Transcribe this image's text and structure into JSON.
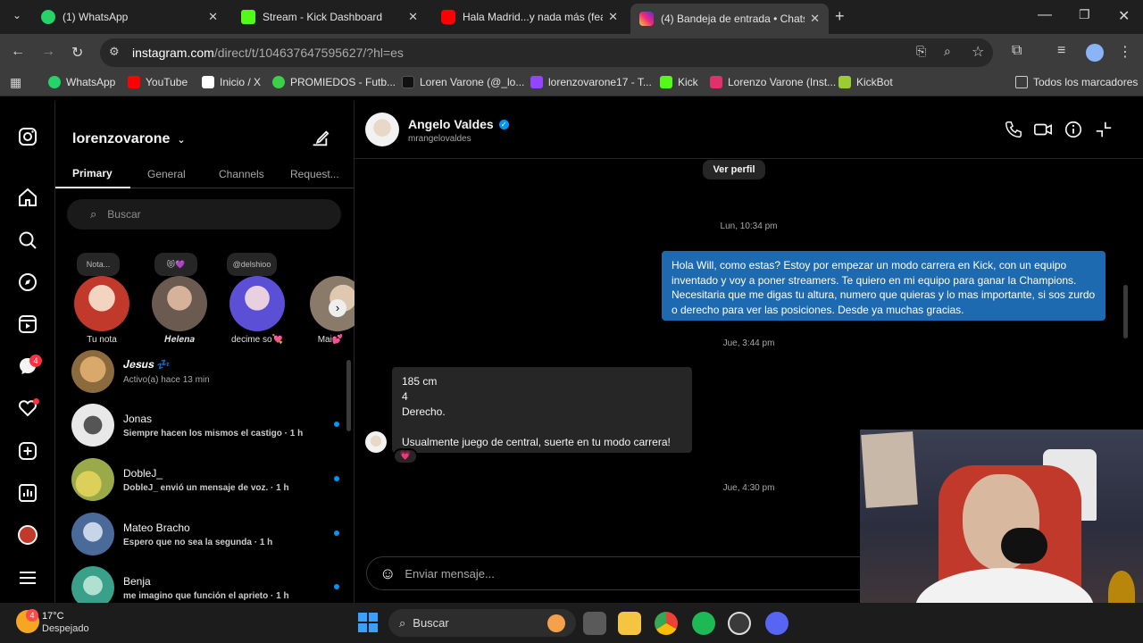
{
  "browser": {
    "tabs": [
      {
        "title": "(1) WhatsApp",
        "color": "#25d366"
      },
      {
        "title": "Stream - Kick Dashboard",
        "color": "#53fc18"
      },
      {
        "title": "Hala Madrid...y nada más (feat.",
        "color": "#ff0000"
      },
      {
        "title": "(4) Bandeja de entrada • Chats",
        "color": "#e1306c"
      }
    ],
    "url_host": "instagram.com",
    "url_path": "/direct/t/104637647595627/?hl=es",
    "bookmarks": [
      {
        "label": "WhatsApp",
        "color": "#25d366"
      },
      {
        "label": "YouTube",
        "color": "#ff0000"
      },
      {
        "label": "Inicio / X",
        "color": "#ffffff"
      },
      {
        "label": "PROMIEDOS - Futb...",
        "color": "#3ecf4a"
      },
      {
        "label": "Loren Varone (@_lo...",
        "color": "#111111"
      },
      {
        "label": "lorenzovarone17 - T...",
        "color": "#9146ff"
      },
      {
        "label": "Kick",
        "color": "#53fc18"
      },
      {
        "label": "Lorenzo Varone (Inst...",
        "color": "#e1306c"
      },
      {
        "label": "KickBot",
        "color": "#9acd32"
      }
    ],
    "all_bookmarks": "Todos los marcadores"
  },
  "inbox": {
    "username": "lorenzovarone",
    "tabs": [
      "Primary",
      "General",
      "Channels",
      "Request..."
    ],
    "search_placeholder": "Buscar",
    "stories": [
      {
        "note": "Nota...",
        "name": "Tu nota",
        "color": "#c0392b"
      },
      {
        "note": "😻💜",
        "name": "𝑯𝒆𝒍𝒆𝒏𝒂",
        "color": "#6b5a4f"
      },
      {
        "note": "@delshioo",
        "name": "decime so💘",
        "color": "#5b4fd6"
      },
      {
        "note": "😻",
        "name": "Mai💕",
        "color": "#8a7a6a"
      }
    ],
    "conversations": [
      {
        "name": "𝑱𝒆𝒔𝒖𝒔 💤",
        "preview": "Activo(a) hace 13 min",
        "unread": false,
        "color": "#8b6a3e"
      },
      {
        "name": "Jonas",
        "preview": "Siempre hacen los mismos el castigo · 1 h",
        "unread": true,
        "color": "#e8e8e8"
      },
      {
        "name": "DobleJ_",
        "preview": "DobleJ_ envió un mensaje de voz. · 1 h",
        "unread": true,
        "color": "#9aa94a"
      },
      {
        "name": "Mateo Bracho",
        "preview": "Espero que no sea la segunda · 1 h",
        "unread": true,
        "color": "#4a6a9a"
      },
      {
        "name": "Benja",
        "preview": "me imagino que función el aprieto · 1 h",
        "unread": true,
        "color": "#3aa08a"
      }
    ],
    "rail_badge": "4"
  },
  "chat": {
    "contact_name": "Angelo Valdes",
    "contact_handle": "mrangelovaldes",
    "view_profile": "Ver perfil",
    "ts1": "Lun, 10:34 pm",
    "outgoing": "Hola Will, como estas? Estoy por empezar un modo carrera en Kick, con un equipo inventado y voy a poner streamers. Te quiero en mi equipo para ganar la Champions. Necesitaria que me digas tu altura, numero que quieras y lo mas importante, si sos zurdo o derecho para ver las posiciones. Desde ya muchas gracias.",
    "ts2": "Jue, 3:44 pm",
    "incoming_lines": [
      "185 cm",
      "4",
      "Derecho."
    ],
    "incoming_2": "Usualmente juego de central, suerte en tu modo carrera!",
    "reaction": "💗",
    "ts3": "Jue, 4:30 pm",
    "input_placeholder": "Enviar mensaje..."
  },
  "taskbar": {
    "weather_temp": "17°C",
    "weather_desc": "Despejado",
    "weather_badge": "4",
    "search": "Buscar"
  }
}
